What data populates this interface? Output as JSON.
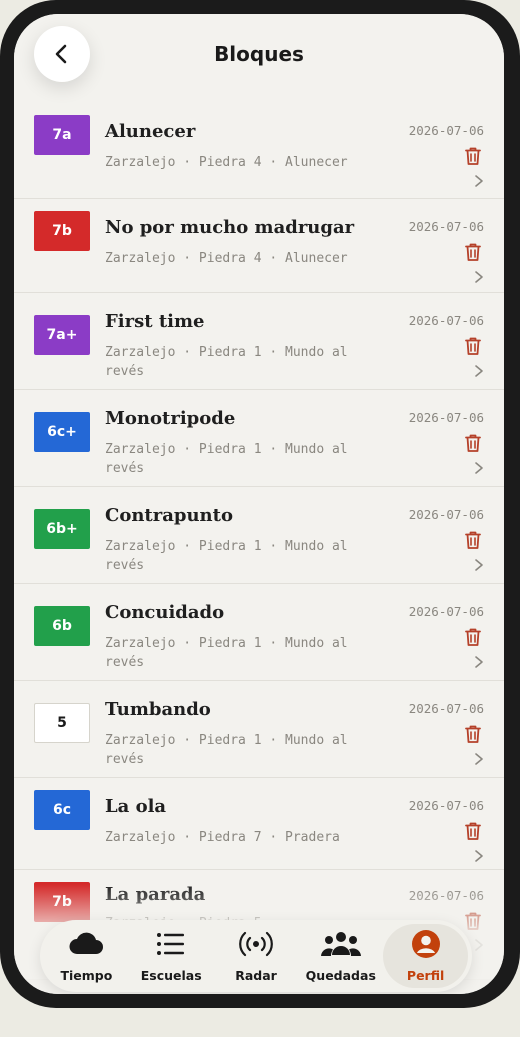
{
  "header": {
    "title": "Bloques"
  },
  "problems": [
    {
      "grade": "7a",
      "color": "#8b3cc6",
      "name": "Alunecer",
      "sub": "Zarzalejo · Piedra 4 · Alunecer",
      "date": "2026-07-06"
    },
    {
      "grade": "7b",
      "color": "#d42a2a",
      "name": "No por mucho madrugar",
      "sub": "Zarzalejo · Piedra 4 · Alunecer",
      "date": "2026-07-06"
    },
    {
      "grade": "7a+",
      "color": "#8b3cc6",
      "name": "First time",
      "sub": "Zarzalejo · Piedra 1 · Mundo al revés",
      "date": "2026-07-06"
    },
    {
      "grade": "6c+",
      "color": "#2468d6",
      "name": "Monotripode",
      "sub": "Zarzalejo · Piedra 1 · Mundo al revés",
      "date": "2026-07-06"
    },
    {
      "grade": "6b+",
      "color": "#22a04b",
      "name": "Contrapunto",
      "sub": "Zarzalejo · Piedra 1 · Mundo al revés",
      "date": "2026-07-06"
    },
    {
      "grade": "6b",
      "color": "#22a04b",
      "name": "Concuidado",
      "sub": "Zarzalejo · Piedra 1 · Mundo al revés",
      "date": "2026-07-06"
    },
    {
      "grade": "5",
      "color": "#ffffff",
      "name": "Tumbando",
      "sub": "Zarzalejo · Piedra 1 · Mundo al revés",
      "date": "2026-07-06"
    },
    {
      "grade": "6c",
      "color": "#2468d6",
      "name": "La ola",
      "sub": "Zarzalejo · Piedra 7 · Pradera",
      "date": "2026-07-06"
    },
    {
      "grade": "7b",
      "color": "#d42a2a",
      "name": "La parada",
      "sub": "Zarzalejo · Piedra 5 ·",
      "date": "2026-07-06"
    }
  ],
  "tabs": [
    {
      "label": "Tiempo",
      "icon": "cloud-icon"
    },
    {
      "label": "Escuelas",
      "icon": "list-icon"
    },
    {
      "label": "Radar",
      "icon": "radar-icon"
    },
    {
      "label": "Quedadas",
      "icon": "group-icon"
    },
    {
      "label": "Perfil",
      "icon": "profile-icon"
    }
  ],
  "colors": {
    "accent": "#c2410c",
    "trash": "#b5412a"
  }
}
